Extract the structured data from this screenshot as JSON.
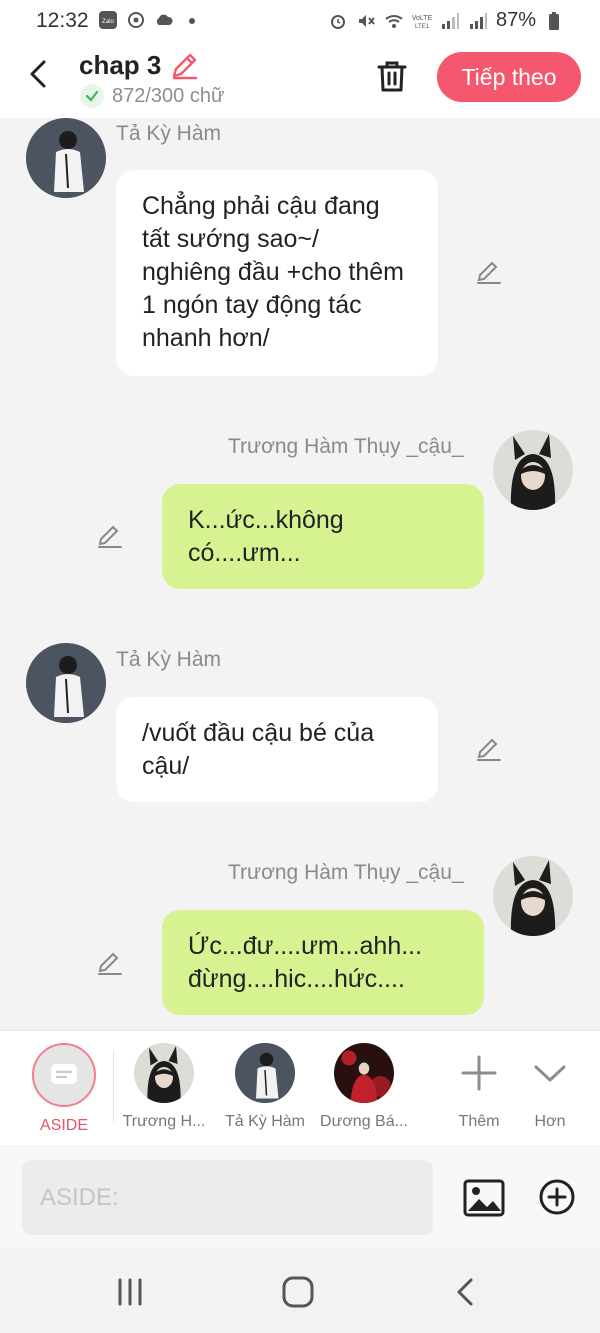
{
  "status_bar": {
    "time": "12:32",
    "battery": "87%"
  },
  "header": {
    "title": "chap 3",
    "word_count": "872/300 chữ",
    "next_label": "Tiếp theo"
  },
  "messages": [
    {
      "side": "left",
      "name": "Tả Kỳ Hàm",
      "text": "Chẳng phải cậu đang tất sướng sao~/ nghiêng đầu +cho thêm 1 ngón tay động tác nhanh hơn/"
    },
    {
      "side": "right",
      "name": "Trương Hàm Thụy _cậu_",
      "text": "K...ức...không có....ưm..."
    },
    {
      "side": "left",
      "name": "Tả Kỳ Hàm",
      "text": "/vuốt đầu cậu bé của cậu/"
    },
    {
      "side": "right",
      "name": "Trương Hàm Thụy _cậu_",
      "text": "Ức...đư....ưm...ahh... đừng....hic....hức...."
    }
  ],
  "toolbar": {
    "aside_label": "ASIDE",
    "characters": [
      "Trương H...",
      "Tả Kỳ Hàm",
      "Dương Bá..."
    ],
    "add_label": "Thêm",
    "more_label": "Hơn"
  },
  "input": {
    "placeholder": "ASIDE:"
  },
  "colors": {
    "accent": "#f5586e",
    "bubble_right": "#d7f291",
    "bubble_left": "#ffffff",
    "background": "#f3f3f3"
  }
}
